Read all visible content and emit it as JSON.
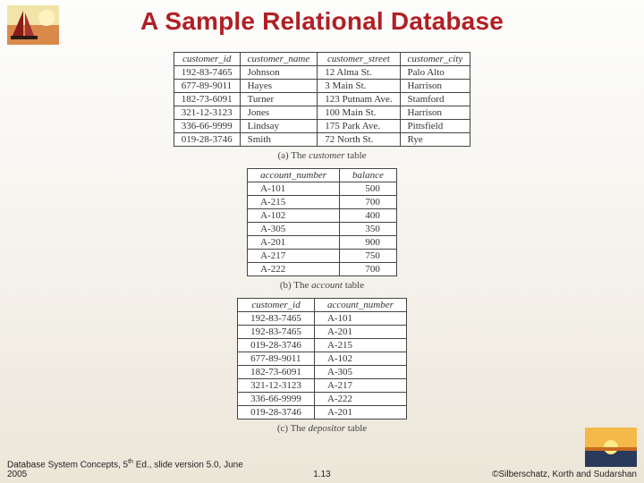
{
  "title": "A Sample Relational Database",
  "tables": {
    "a": {
      "headers": [
        "customer_id",
        "customer_name",
        "customer_street",
        "customer_city"
      ],
      "rows": [
        [
          "192-83-7465",
          "Johnson",
          "12 Alma St.",
          "Palo Alto"
        ],
        [
          "677-89-9011",
          "Hayes",
          "3 Main St.",
          "Harrison"
        ],
        [
          "182-73-6091",
          "Turner",
          "123 Putnam Ave.",
          "Stamford"
        ],
        [
          "321-12-3123",
          "Jones",
          "100 Main St.",
          "Harrison"
        ],
        [
          "336-66-9999",
          "Lindsay",
          "175 Park Ave.",
          "Pittsfield"
        ],
        [
          "019-28-3746",
          "Smith",
          "72 North St.",
          "Rye"
        ]
      ],
      "caption_prefix": "(a) The ",
      "caption_ital": "customer",
      "caption_suffix": " table"
    },
    "b": {
      "headers": [
        "account_number",
        "balance"
      ],
      "rows": [
        [
          "A-101",
          "500"
        ],
        [
          "A-215",
          "700"
        ],
        [
          "A-102",
          "400"
        ],
        [
          "A-305",
          "350"
        ],
        [
          "A-201",
          "900"
        ],
        [
          "A-217",
          "750"
        ],
        [
          "A-222",
          "700"
        ]
      ],
      "caption_prefix": "(b) The ",
      "caption_ital": "account",
      "caption_suffix": " table"
    },
    "c": {
      "headers": [
        "customer_id",
        "account_number"
      ],
      "rows": [
        [
          "192-83-7465",
          "A-101"
        ],
        [
          "192-83-7465",
          "A-201"
        ],
        [
          "019-28-3746",
          "A-215"
        ],
        [
          "677-89-9011",
          "A-102"
        ],
        [
          "182-73-6091",
          "A-305"
        ],
        [
          "321-12-3123",
          "A-217"
        ],
        [
          "336-66-9999",
          "A-222"
        ],
        [
          "019-28-3746",
          "A-201"
        ]
      ],
      "caption_prefix": "(c) The ",
      "caption_ital": "depositor",
      "caption_suffix": " table"
    }
  },
  "footer": {
    "left_a": "Database System Concepts, 5",
    "left_sup": "th",
    "left_b": " Ed., slide version 5.0, June 2005",
    "mid": "1.13",
    "right": "©Silberschatz, Korth and Sudarshan"
  }
}
